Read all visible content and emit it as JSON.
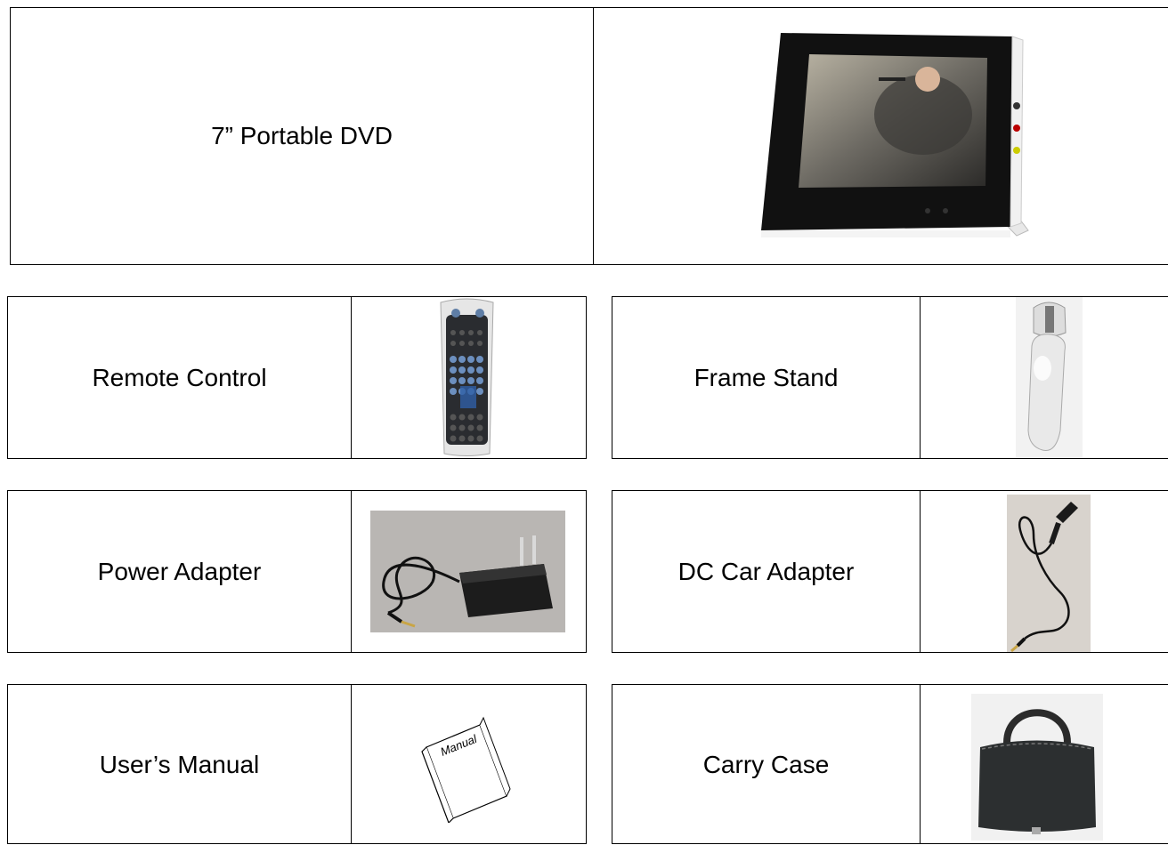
{
  "items": {
    "main": {
      "label": "7” Portable DVD",
      "image": "portable-dvd-player-photo"
    },
    "remote": {
      "label": "Remote Control",
      "image": "remote-control-photo"
    },
    "stand": {
      "label": "Frame Stand",
      "image": "frame-stand-photo"
    },
    "power": {
      "label": "Power Adapter",
      "image": "power-adapter-photo"
    },
    "car": {
      "label": "DC Car Adapter",
      "image": "car-adapter-photo"
    },
    "manual": {
      "label": "User’s Manual",
      "image": "manual-booklet-drawing",
      "booklet_text": "Manual"
    },
    "case": {
      "label": "Carry Case",
      "image": "carry-case-photo"
    }
  }
}
